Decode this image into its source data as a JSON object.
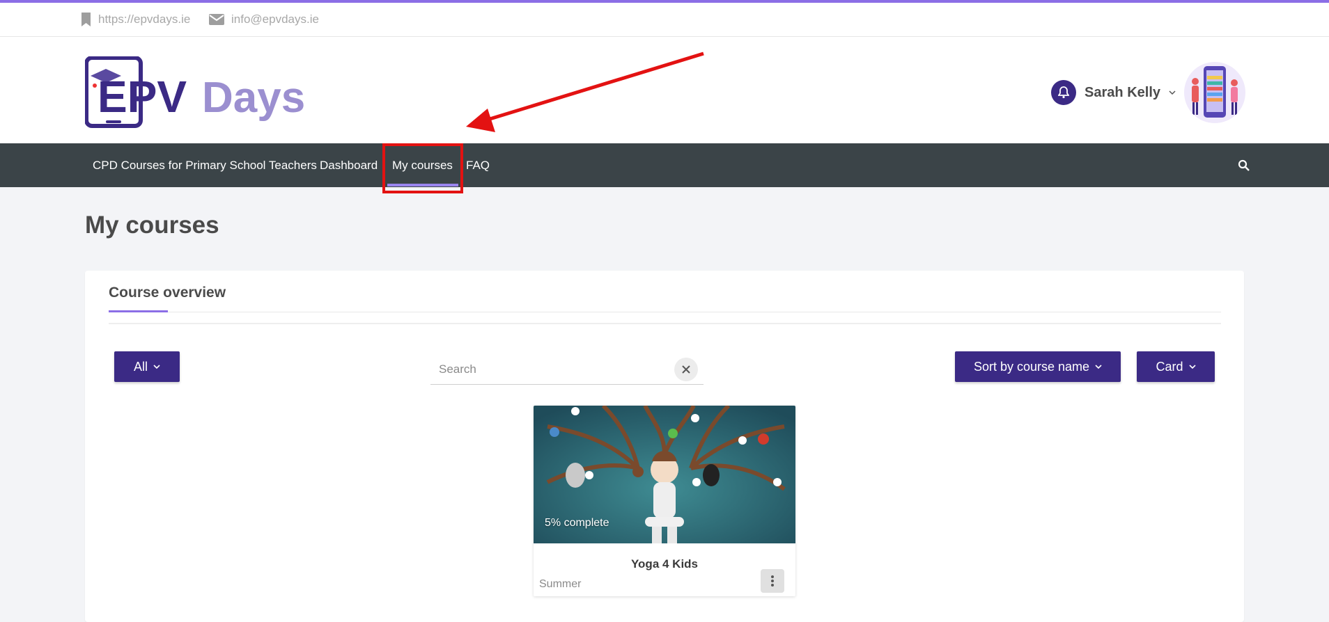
{
  "topbar": {
    "website": "https://epvdays.ie",
    "email": "info@epvdays.ie"
  },
  "header": {
    "logo_text": "EPV Days",
    "user_name": "Sarah Kelly"
  },
  "nav": {
    "items": [
      {
        "label": "CPD Courses for Primary School Teachers"
      },
      {
        "label": "Dashboard"
      },
      {
        "label": "My courses"
      },
      {
        "label": "FAQ"
      }
    ]
  },
  "page": {
    "title": "My courses"
  },
  "overview": {
    "title": "Course overview",
    "filter_label": "All",
    "search_placeholder": "Search",
    "sort_label": "Sort by course name",
    "view_label": "Card"
  },
  "course": {
    "name": "Yoga 4 Kids",
    "category": "Summer",
    "progress_text": "5% complete",
    "progress": 5
  },
  "colors": {
    "accent": "#8b6ee6",
    "brand": "#3b2a85",
    "nav_bg": "#3b4448",
    "highlight": "#e31212"
  }
}
